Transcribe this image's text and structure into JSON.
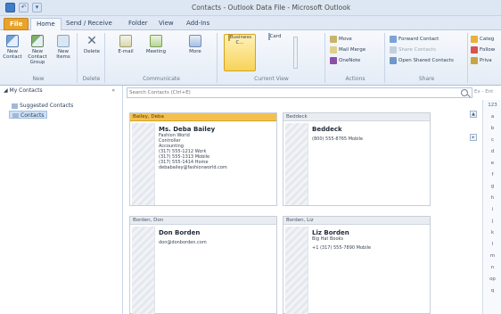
{
  "window": {
    "title": "Contacts - Outlook Data File - Microsoft Outlook"
  },
  "quick_access": {
    "app_icon": "outlook-icon",
    "undo_icon": "undo-icon",
    "menu_icon": "chevron-down-icon"
  },
  "tabs": [
    {
      "label": "File"
    },
    {
      "label": "Home"
    },
    {
      "label": "Send / Receive"
    },
    {
      "label": "Folder"
    },
    {
      "label": "View"
    },
    {
      "label": "Add-Ins"
    }
  ],
  "ribbon": {
    "new_group": {
      "label": "New",
      "new_contact": "New Contact",
      "new_contact_group": "New Contact Group",
      "new_items": "New Items"
    },
    "delete_group": {
      "label": "Delete",
      "delete": "Delete"
    },
    "communicate_group": {
      "label": "Communicate",
      "email": "E-mail",
      "meeting": "Meeting",
      "more": "More"
    },
    "current_view_group": {
      "label": "Current View",
      "business_card": "Business C...",
      "card": "Card"
    },
    "actions_group": {
      "label": "Actions",
      "move": "Move",
      "mail_merge": "Mail Merge",
      "onenote": "OneNote"
    },
    "share_group": {
      "label": "Share",
      "forward_contact": "Forward Contact",
      "share_contacts": "Share Contacts",
      "open_shared": "Open Shared Contacts"
    },
    "tags_group": {
      "categorize": "Categ",
      "follow_up": "Follow",
      "private": "Priva"
    }
  },
  "nav": {
    "header": "My Contacts",
    "collapse_glyph": "«",
    "items": [
      {
        "label": "Suggested Contacts"
      },
      {
        "label": "Contacts"
      }
    ]
  },
  "search": {
    "placeholder": "Search Contacts (Ctrl+E)",
    "scope": "Ex - Ent"
  },
  "cards": [
    {
      "file_as": "Bailey, Deba",
      "name": "Ms. Deba Bailey",
      "lines": [
        "Fashion World",
        "Controller",
        "Accounting"
      ],
      "phones": [
        "(317) 555-1212 Work",
        "(317) 555-1313 Mobile",
        "(317) 555-1414 Home"
      ],
      "email": "debabailey@fashionworld.com",
      "selected": true
    },
    {
      "file_as": "Beddeck",
      "name": "Beddeck",
      "lines": [],
      "phones": [
        "(800) 555-8765 Mobile"
      ],
      "email": "",
      "selected": false
    },
    {
      "file_as": "Borden, Don",
      "name": "Don Borden",
      "lines": [],
      "phones": [],
      "email": "don@donborden.com",
      "selected": false
    },
    {
      "file_as": "Borden, Liz",
      "name": "Liz Borden",
      "lines": [
        "Big Hat Books"
      ],
      "phones": [
        "+1 (317) 555-7890 Mobile"
      ],
      "email": "",
      "selected": false
    }
  ],
  "alphabet": [
    "123",
    "a",
    "b",
    "c",
    "d",
    "e",
    "f",
    "g",
    "h",
    "i",
    "j",
    "k",
    "l",
    "m",
    "n",
    "op",
    "q"
  ],
  "colors": {
    "accent": "#f3c050",
    "file_tab": "#e8a32a",
    "ribbon": "#e4ecf6"
  }
}
